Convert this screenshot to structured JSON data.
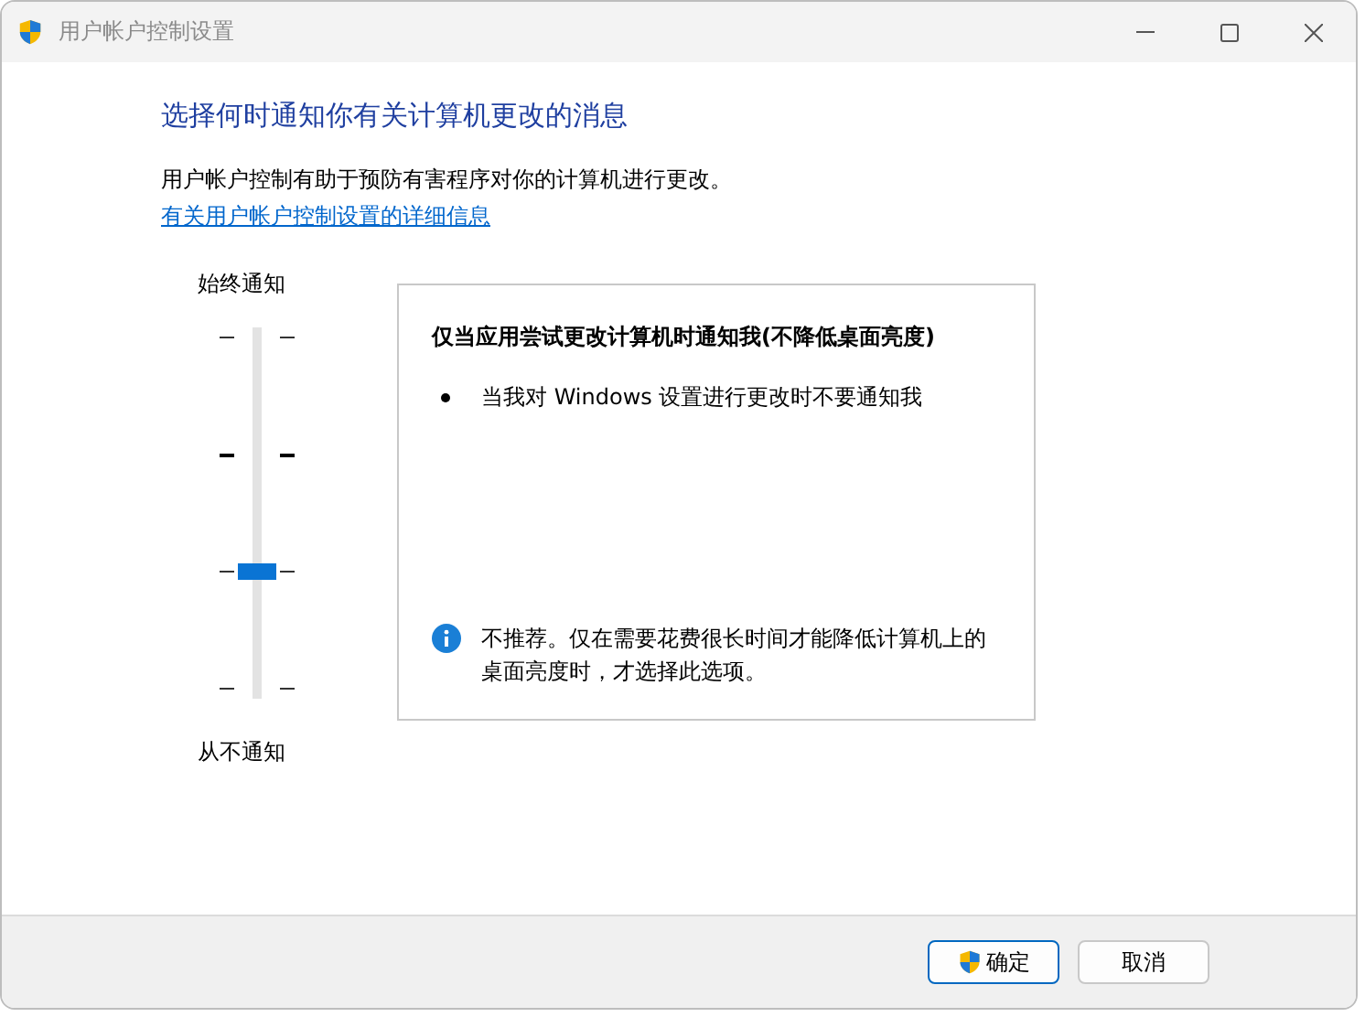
{
  "window": {
    "title": "用户帐户控制设置"
  },
  "heading": "选择何时通知你有关计算机更改的消息",
  "description": "用户帐户控制有助于预防有害程序对你的计算机进行更改。",
  "link": "有关用户帐户控制设置的详细信息",
  "slider": {
    "top_label": "始终通知",
    "bottom_label": "从不通知",
    "level": 0.333,
    "ticks": [
      {
        "emphasized": false
      },
      {
        "emphasized": true
      },
      {
        "emphasized": false
      },
      {
        "emphasized": false
      }
    ]
  },
  "detail": {
    "title": "仅当应用尝试更改计算机时通知我(不降低桌面亮度)",
    "bullets": [
      "当我对 Windows 设置进行更改时不要通知我"
    ],
    "note": "不推荐。仅在需要花费很长时间才能降低计算机上的桌面亮度时，才选择此选项。"
  },
  "buttons": [
    {
      "label": "确定",
      "kind": "shield",
      "default": true
    },
    {
      "label": "取消",
      "kind": "plain",
      "default": false
    }
  ]
}
